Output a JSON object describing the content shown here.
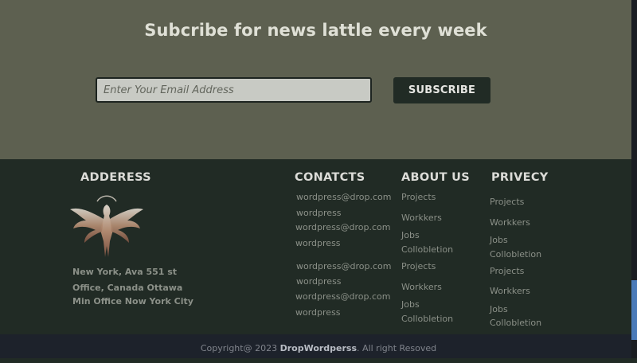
{
  "subscribe": {
    "title": "Subcribe for news lattle every week",
    "email_placeholder": "Enter Your Email Address",
    "button_label": "SUBSCRIBE"
  },
  "address": {
    "heading": "ADDERESS",
    "lines": [
      "New York, Ava 551 st",
      "Office, Canada Ottawa",
      "Min Office Now  York City"
    ]
  },
  "contacts": {
    "heading": "CONATCTS",
    "items": [
      "wordpress@drop.com",
      "wordpress",
      "wordpress@drop.com",
      "wordpress",
      "wordpress@drop.com",
      "wordpress",
      "wordpress@drop.com",
      "wordpress"
    ]
  },
  "about": {
    "heading": "ABOUT US",
    "items": [
      "Projects",
      "Workkers",
      "Jobs",
      "Collobletion",
      "Projects",
      "Workkers",
      "Jobs",
      "Collobletion"
    ]
  },
  "privacy": {
    "heading": "PRIVECY",
    "items": [
      "Projects",
      "Workkers",
      "Jobs",
      "Collobletion",
      "Projects",
      "Workkers",
      "Jobs",
      "Collobletion"
    ]
  },
  "footer": {
    "copyright_prefix": "Copyright@ 2023",
    "brand": "DropWordperss",
    "copyright_suffix": ". All right Resoved"
  },
  "colors": {
    "subscribe_bg": "#5d6050",
    "footer_bg": "#212b25",
    "bottom_bar_bg": "#1d222b",
    "scroll_thumb": "#4a7ab8"
  }
}
